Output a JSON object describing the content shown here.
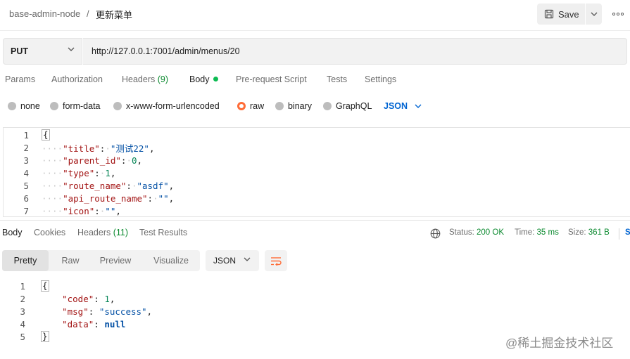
{
  "breadcrumb": {
    "collection": "base-admin-node",
    "separator": "/",
    "request_name": "更新菜单"
  },
  "toolbar": {
    "save_label": "Save",
    "more_label": "ooo"
  },
  "request": {
    "method": "PUT",
    "url": "http://127.0.0.1:7001/admin/menus/20"
  },
  "request_tabs": {
    "params": "Params",
    "authorization": "Authorization",
    "headers": "Headers",
    "headers_count": "(9)",
    "body": "Body",
    "pre_request": "Pre-request Script",
    "tests": "Tests",
    "settings": "Settings"
  },
  "body_types": {
    "none": "none",
    "form_data": "form-data",
    "urlencoded": "x-www-form-urlencoded",
    "raw": "raw",
    "binary": "binary",
    "graphql": "GraphQL",
    "selected": "raw",
    "language": "JSON"
  },
  "request_body": {
    "lines": [
      {
        "num": "1",
        "open": "{"
      },
      {
        "num": "2",
        "key": "\"title\"",
        "value": "\"测试22\"",
        "value_type": "string",
        "trail": ","
      },
      {
        "num": "3",
        "key": "\"parent_id\"",
        "value": "0",
        "value_type": "number",
        "trail": ","
      },
      {
        "num": "4",
        "key": "\"type\"",
        "value": "1",
        "value_type": "number",
        "trail": ","
      },
      {
        "num": "5",
        "key": "\"route_name\"",
        "value": "\"asdf\"",
        "value_type": "string",
        "trail": ","
      },
      {
        "num": "6",
        "key": "\"api_route_name\"",
        "value": "\"\"",
        "value_type": "string",
        "trail": ","
      },
      {
        "num": "7",
        "key": "\"icon\"",
        "value": "\"\"",
        "value_type": "string",
        "trail": ","
      }
    ]
  },
  "response_tabs": {
    "body": "Body",
    "cookies": "Cookies",
    "headers": "Headers",
    "headers_count": "(11)",
    "test_results": "Test Results"
  },
  "response_meta": {
    "status_label": "Status:",
    "status_value": "200 OK",
    "time_label": "Time:",
    "time_value": "35 ms",
    "size_label": "Size:",
    "size_value": "361 B",
    "save_response": "S"
  },
  "view_tabs": [
    "Pretty",
    "Raw",
    "Preview",
    "Visualize"
  ],
  "response_format": "JSON",
  "response_body": {
    "line1": {
      "num": "1",
      "text": "{"
    },
    "line2": {
      "num": "2",
      "key": "\"code\"",
      "value": "1"
    },
    "line3": {
      "num": "3",
      "key": "\"msg\"",
      "value": "\"success\""
    },
    "line4": {
      "num": "4",
      "key": "\"data\"",
      "value": "null"
    },
    "line5": {
      "num": "5",
      "text": "}"
    }
  },
  "watermark": "@稀土掘金技术社区",
  "colors": {
    "accent_orange": "#ff6c37",
    "status_green": "#0b8a2f",
    "link_blue": "#0265d2",
    "json_key": "#a31515",
    "json_string": "#0451a5",
    "json_number": "#098658"
  }
}
